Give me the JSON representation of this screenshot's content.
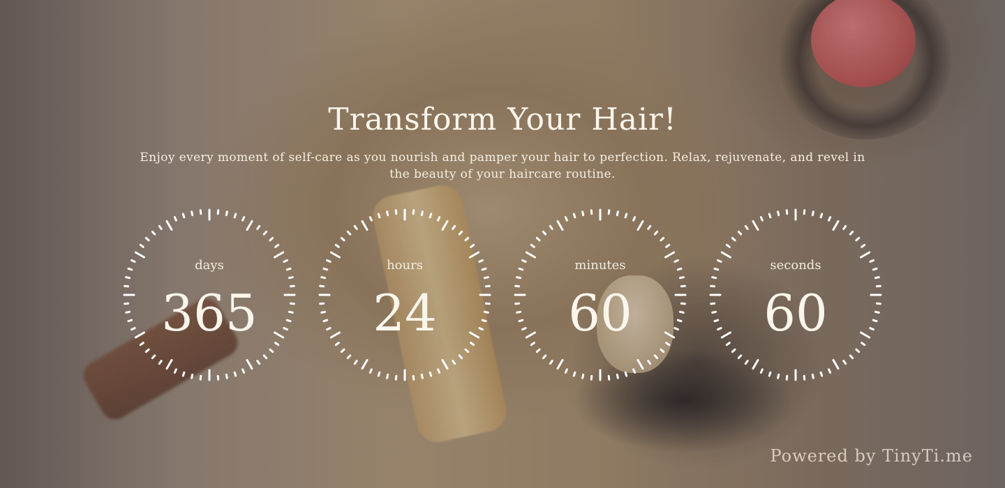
{
  "hero": {
    "title": "Transform Your Hair!",
    "subtitle": "Enjoy every moment of self-care as you nourish and pamper your hair to perfection. Relax, rejuvenate, and revel in the beauty of your haircare routine."
  },
  "countdown": [
    {
      "label": "days",
      "value": "365"
    },
    {
      "label": "hours",
      "value": "24"
    },
    {
      "label": "minutes",
      "value": "60"
    },
    {
      "label": "seconds",
      "value": "60"
    }
  ],
  "footer": {
    "powered_by": "Powered by TinyTi.me"
  },
  "colors": {
    "text": "#fbf6ec",
    "dial": "#ffffff"
  }
}
